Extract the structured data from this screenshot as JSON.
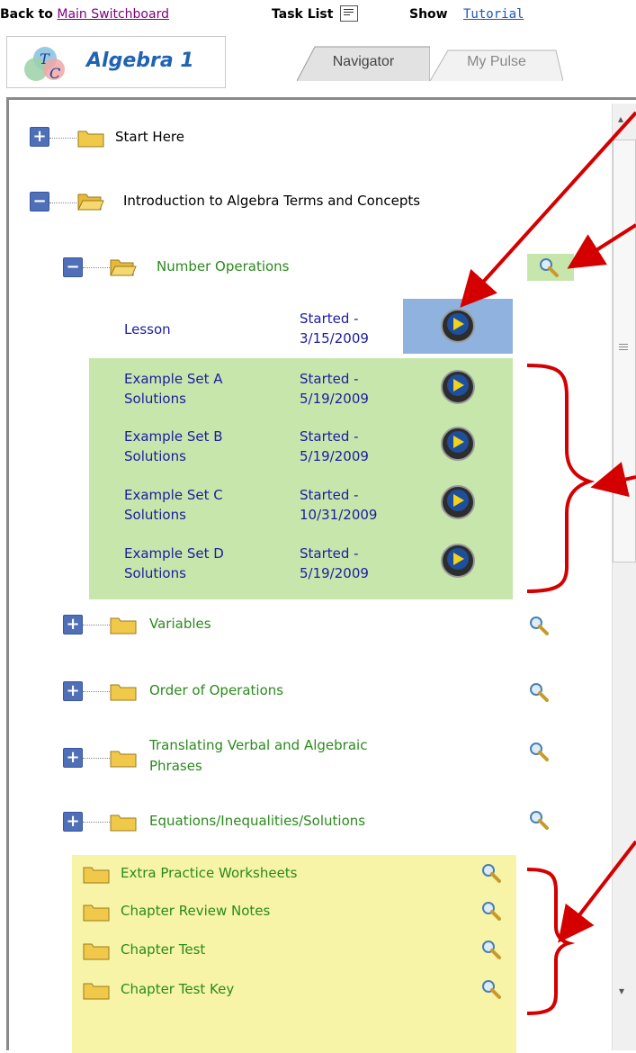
{
  "topbar": {
    "back_prefix": "Back to",
    "back_link": "Main Switchboard",
    "task_list": "Task List",
    "show": "Show",
    "tutorial": "Tutorial"
  },
  "logo": {
    "text": "Algebra 1",
    "letter_t": "T",
    "letter_c": "C"
  },
  "tabs": [
    {
      "label": "Navigator"
    },
    {
      "label": "My Pulse"
    }
  ],
  "tree": {
    "start_here": "Start Here",
    "intro": "Introduction to Algebra Terms and Concepts",
    "number_operations": "Number Operations",
    "lesson": {
      "label": "Lesson",
      "status_line1": "Started -",
      "status_line2": "3/15/2009"
    },
    "examples": [
      {
        "line1": "Example Set A",
        "line2": "Solutions",
        "status1": "Started -",
        "status2": "5/19/2009"
      },
      {
        "line1": "Example Set B",
        "line2": "Solutions",
        "status1": "Started -",
        "status2": "5/19/2009"
      },
      {
        "line1": "Example Set C",
        "line2": "Solutions",
        "status1": "Started -",
        "status2": "10/31/2009"
      },
      {
        "line1": "Example Set D",
        "line2": "Solutions",
        "status1": "Started -",
        "status2": "5/19/2009"
      }
    ],
    "variables": "Variables",
    "order_of_operations": "Order of Operations",
    "translating_line1": "Translating Verbal and Algebraic",
    "translating_line2": "Phrases",
    "equations": "Equations/Inequalities/Solutions",
    "extras": [
      "Extra Practice Worksheets",
      "Chapter Review Notes",
      "Chapter Test",
      "Chapter Test Key"
    ]
  },
  "icons": {
    "plus": "+",
    "minus": "−",
    "scroll_up": "▴",
    "scroll_down": "▾"
  },
  "colors": {
    "green_text": "#2a8a1c",
    "navy_text": "#1c1ca0",
    "blue_highlight": "#8fb2de",
    "green_highlight": "#c7e6ac",
    "yellow_highlight": "#f7f4a8",
    "annotation_red": "#d40000"
  }
}
